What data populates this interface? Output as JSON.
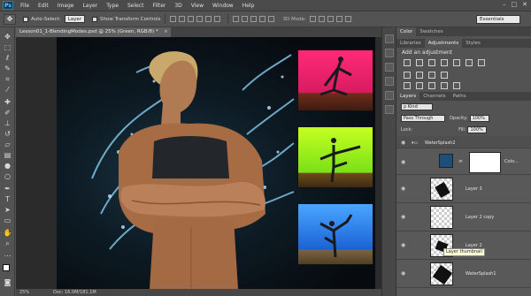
{
  "app": {
    "logo": "Ps",
    "menu": [
      "File",
      "Edit",
      "Image",
      "Layer",
      "Type",
      "Select",
      "Filter",
      "3D",
      "View",
      "Window",
      "Help"
    ],
    "window_controls": [
      "–",
      "□",
      "✕"
    ]
  },
  "options_bar": {
    "auto_select_label": "Auto-Select:",
    "auto_select_value": "Layer",
    "transform_label": "Show Transform Controls",
    "mode_3d_label": "3D Mode:",
    "workspace": "Essentials"
  },
  "document": {
    "tab_title": "Lesson01_1-BlendingModes.psd @ 25% (Green, RGB/8) *",
    "zoom": "25%",
    "doc_size": "Doc: 16.0M/181.1M"
  },
  "panels": {
    "top_tabs": [
      "Color",
      "Swatches"
    ],
    "adjust_tabs": [
      "Libraries",
      "Adjustments",
      "Styles"
    ],
    "adjust_title": "Add an adjustment",
    "layers_tabs": [
      "Layers",
      "Channels",
      "Paths"
    ],
    "kind_filter": "ρ Kind",
    "blend_mode": "Pass Through",
    "opacity_label": "Opacity:",
    "opacity_value": "100%",
    "lock_label": "Lock:",
    "fill_label": "Fill:",
    "fill_value": "100%"
  },
  "layers": [
    {
      "name": "WaterSplash2",
      "type": "group"
    },
    {
      "name": "Colo...",
      "type": "fill"
    },
    {
      "name": "Layer 3",
      "type": "layer"
    },
    {
      "name": "Layer 2 copy",
      "type": "layer"
    },
    {
      "name": "Layer 2",
      "type": "layer"
    },
    {
      "name": "WaterSplash1",
      "type": "layer"
    }
  ],
  "tooltip": "Layer thumbnail",
  "icons": {
    "eye": "eye-icon",
    "move": "move-tool-icon"
  },
  "colors": {
    "accent": "#1c4f7a",
    "photo_pink": "#ff2a78",
    "photo_green": "#9aff1a",
    "photo_blue": "#2a86ff"
  }
}
